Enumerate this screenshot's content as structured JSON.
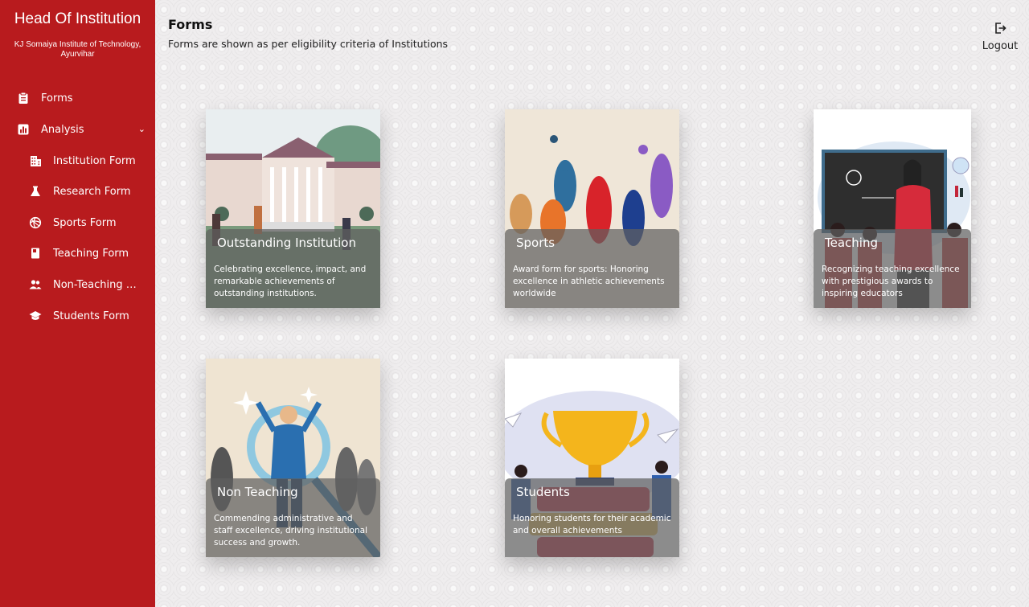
{
  "sidebar": {
    "title": "Head Of Institution",
    "institution": "KJ Somaiya Institute of Technology, Ayurvihar",
    "items": [
      {
        "label": "Forms",
        "icon": "clipboard-icon"
      },
      {
        "label": "Analysis",
        "icon": "bar-chart-icon",
        "chevron": "⌄"
      },
      {
        "label": "Institution Form",
        "icon": "building-icon"
      },
      {
        "label": "Research Form",
        "icon": "flask-icon"
      },
      {
        "label": "Sports Form",
        "icon": "ball-icon"
      },
      {
        "label": "Teaching Form",
        "icon": "book-icon"
      },
      {
        "label": "Non-Teaching F...",
        "icon": "people-icon"
      },
      {
        "label": "Students Form",
        "icon": "graduation-cap-icon"
      }
    ]
  },
  "header": {
    "title": "Forms",
    "subtitle": "Forms are shown as per eligibility criteria of Institutions",
    "logout_label": "Logout",
    "logout_icon": "logout-icon"
  },
  "cards": [
    {
      "title": "Outstanding Institution",
      "description": "Celebrating excellence, impact, and remarkable achievements of outstanding institutions."
    },
    {
      "title": "Sports",
      "description": "Award form for sports: Honoring excellence in athletic achievements worldwide"
    },
    {
      "title": "Teaching",
      "description": "Recognizing teaching excellence with prestigious awards to inspiring educators"
    },
    {
      "title": "Non Teaching",
      "description": "Commending administrative and staff excellence, driving institutional success and growth."
    },
    {
      "title": "Students",
      "description": "Honoring students for their academic and overall achievements"
    }
  ],
  "colors": {
    "sidebar": "#b81b1e",
    "background": "#efedee"
  }
}
